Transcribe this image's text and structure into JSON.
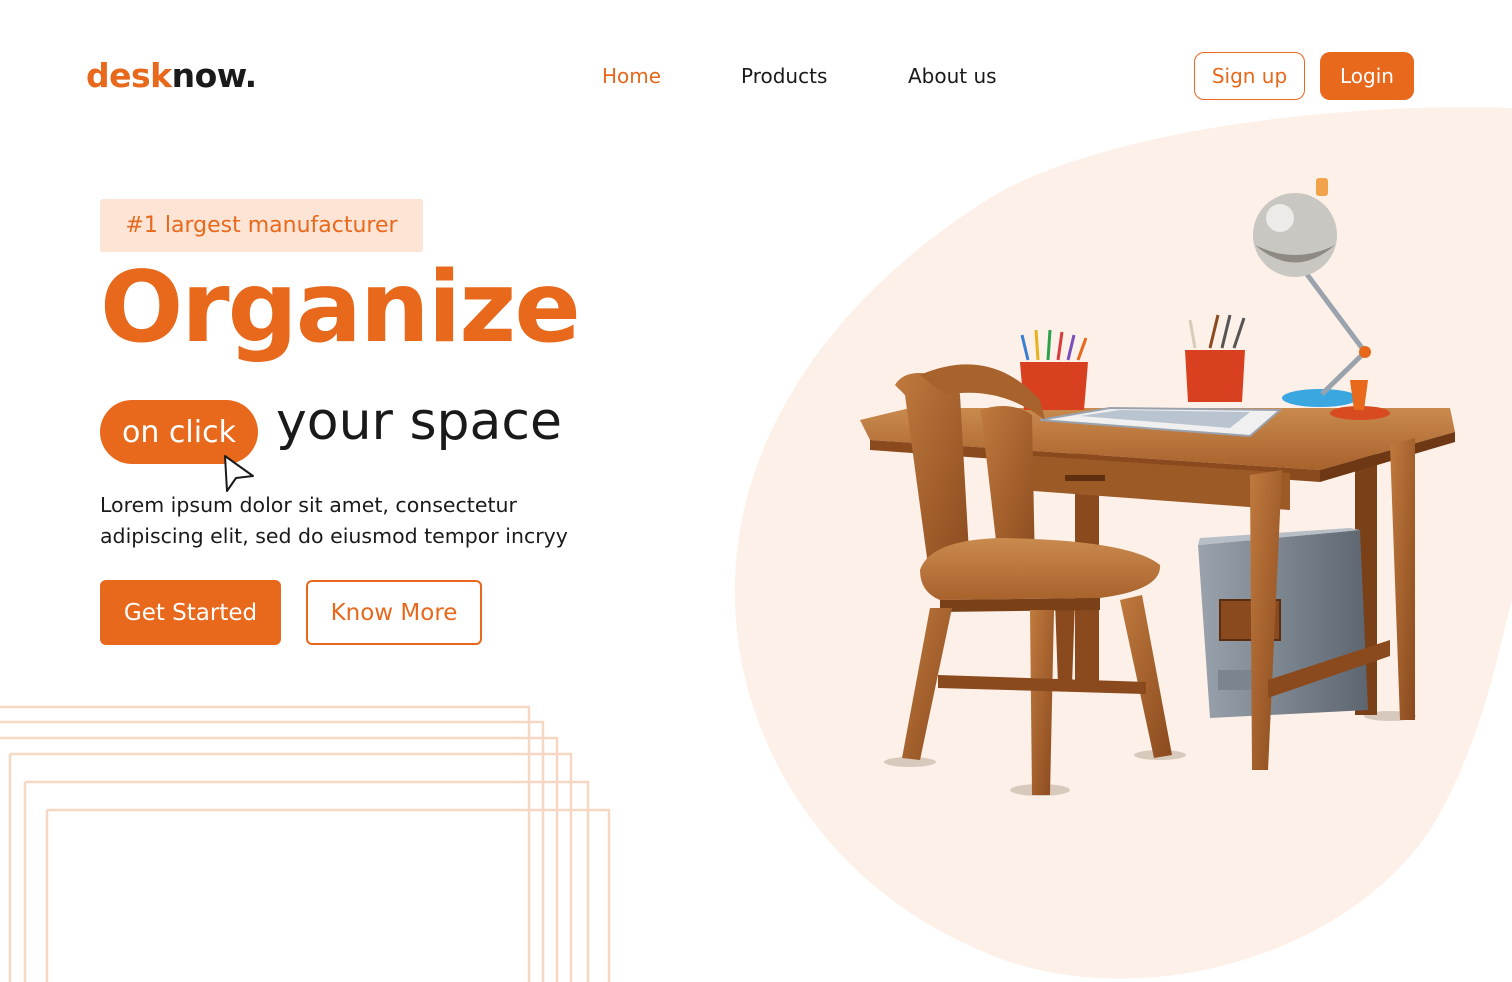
{
  "brand": {
    "part1": "desk",
    "part2": "now."
  },
  "nav": {
    "home": "Home",
    "products": "Products",
    "about": "About us"
  },
  "auth": {
    "signup": "Sign up",
    "login": "Login"
  },
  "hero": {
    "badge": "#1 largest manufacturer",
    "headline": "Organize",
    "pill": "on click",
    "subhead": "your space",
    "paragraph_line1": "Lorem ipsum dolor sit amet, consectetur",
    "paragraph_line2": "adipiscing elit, sed do eiusmod tempor incryy",
    "cta_primary": "Get Started",
    "cta_secondary": "Know More"
  },
  "colors": {
    "accent": "#e8681c",
    "accent_light": "#fde4d5",
    "blob": "#fdf0e8",
    "text": "#1a1a1a"
  },
  "icons": {
    "cursor": "cursor-arrow-icon"
  }
}
